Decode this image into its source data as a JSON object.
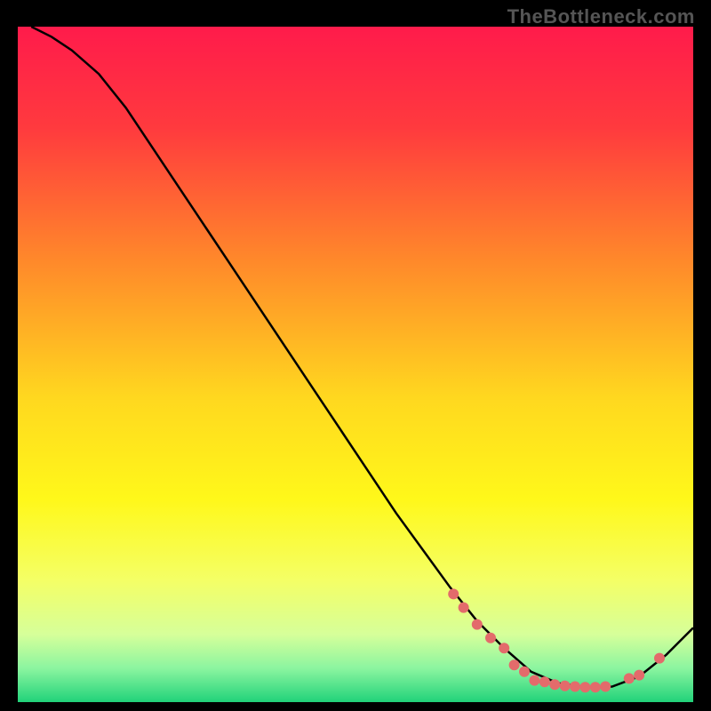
{
  "watermark": "TheBottleneck.com",
  "chart_data": {
    "type": "line",
    "title": "",
    "xlabel": "",
    "ylabel": "",
    "xlim": [
      0,
      100
    ],
    "ylim": [
      0,
      100
    ],
    "grid": false,
    "series": [
      {
        "name": "curve",
        "color": "#000000",
        "x": [
          2,
          5,
          8,
          12,
          16,
          20,
          24,
          28,
          32,
          36,
          40,
          44,
          48,
          52,
          56,
          60,
          64,
          68,
          72,
          76,
          80,
          84,
          88,
          92,
          96,
          100
        ],
        "y": [
          100,
          98.5,
          96.5,
          93,
          88,
          82,
          76,
          70,
          64,
          58,
          52,
          46,
          40,
          34,
          28,
          22.5,
          17,
          12,
          8,
          4.5,
          2.8,
          2.2,
          2.3,
          3.8,
          7,
          11
        ]
      },
      {
        "name": "points",
        "color": "#e36b6b",
        "type": "scatter",
        "x": [
          64.5,
          66,
          68,
          70,
          72,
          73.5,
          75,
          76.5,
          78,
          79.5,
          81,
          82.5,
          84,
          85.5,
          87,
          90.5,
          92,
          95
        ],
        "y": [
          16,
          14,
          11.5,
          9.5,
          8,
          5.5,
          4.5,
          3.2,
          3.0,
          2.6,
          2.4,
          2.3,
          2.2,
          2.2,
          2.3,
          3.5,
          4.0,
          6.5
        ]
      }
    ],
    "background_gradient": {
      "stops": [
        {
          "offset": 0.0,
          "color": "#ff1b4b"
        },
        {
          "offset": 0.15,
          "color": "#ff3a3e"
        },
        {
          "offset": 0.35,
          "color": "#ff8a2a"
        },
        {
          "offset": 0.55,
          "color": "#ffd81f"
        },
        {
          "offset": 0.7,
          "color": "#fff81a"
        },
        {
          "offset": 0.82,
          "color": "#f4ff66"
        },
        {
          "offset": 0.9,
          "color": "#d6ff9a"
        },
        {
          "offset": 0.95,
          "color": "#8bf5a0"
        },
        {
          "offset": 1.0,
          "color": "#21d27a"
        }
      ]
    }
  }
}
